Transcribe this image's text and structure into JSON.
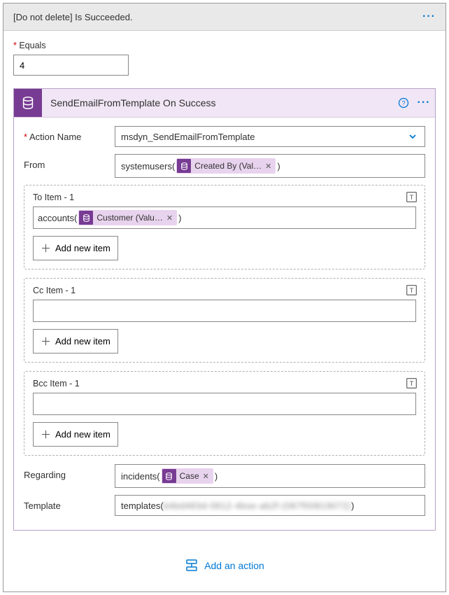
{
  "header": {
    "title": "[Do not delete] Is Succeeded."
  },
  "equals": {
    "label": "Equals",
    "value": "4"
  },
  "card": {
    "title": "SendEmailFromTemplate On Success"
  },
  "actionName": {
    "label": "Action Name",
    "value": "msdyn_SendEmailFromTemplate"
  },
  "from": {
    "label": "From",
    "prefix": "systemusers(",
    "token": "Created By (Val…",
    "suffix": ")"
  },
  "to": {
    "title": "To Item - 1",
    "prefix": "accounts(",
    "token": "Customer (Valu…",
    "suffix": ")",
    "add": "Add new item"
  },
  "cc": {
    "title": "Cc Item - 1",
    "add": "Add new item"
  },
  "bcc": {
    "title": "Bcc Item - 1",
    "add": "Add new item"
  },
  "regarding": {
    "label": "Regarding",
    "prefix": "incidents(",
    "token": "Case",
    "suffix": ")"
  },
  "template": {
    "label": "Template",
    "prefix": "templates(",
    "blurred": "b4bd483d-0812-4bse-ab2f-(087f00819072)",
    "suffix": ")"
  },
  "footer": {
    "addAction": "Add an action"
  }
}
